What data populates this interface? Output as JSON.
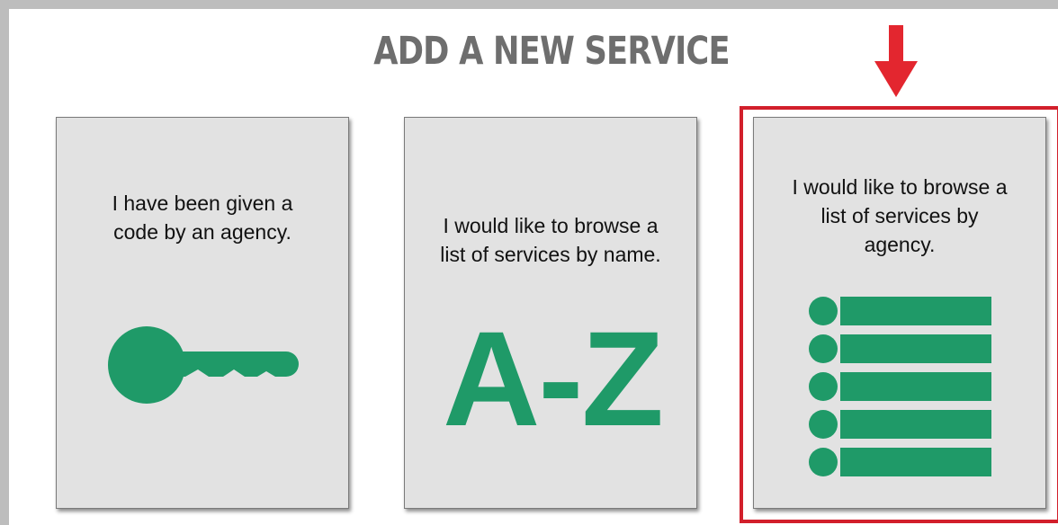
{
  "page": {
    "title": "ADD A NEW SERVICE"
  },
  "cards": [
    {
      "text": "I have been given a\ncode by an agency.",
      "icon": "key-icon"
    },
    {
      "text": "I would like to browse a\nlist of services by name.",
      "icon": "a-z-icon",
      "icon_text": "A-Z"
    },
    {
      "text": "I would like to browse a\nlist of services by\nagency.",
      "icon": "list-icon",
      "highlighted": true
    }
  ],
  "colors": {
    "accent_green": "#1f9a68",
    "card_background": "#e2e2e2",
    "highlight_red": "#d21f2b",
    "title_gray": "#6e6e6e"
  }
}
